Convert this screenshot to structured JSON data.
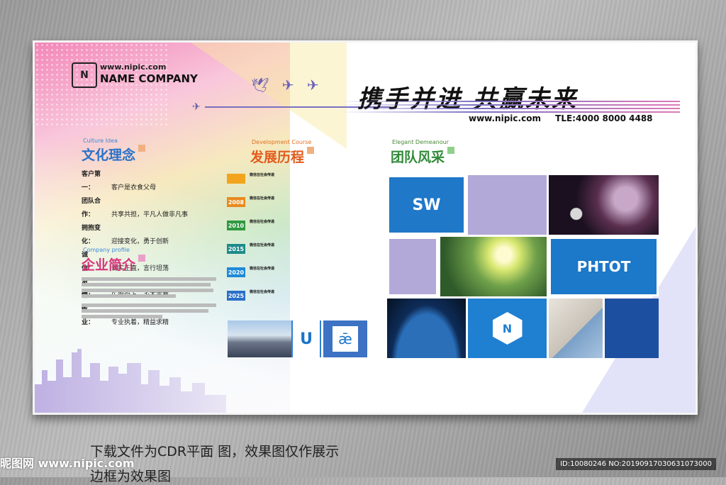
{
  "header": {
    "site_url": "www.nipic.com",
    "company": "NAME COMPANY",
    "logo_text": "N",
    "slogan": "携手并进 共赢未来",
    "contact_url": "www.nipic.com",
    "phone": "TLE:4000 8000 4488"
  },
  "culture": {
    "en": "Culture Idea",
    "title": "文化理念",
    "items": [
      {
        "k": "客户第一：",
        "v": "客户是衣食父母"
      },
      {
        "k": "团队合作：",
        "v": "共享共担，平凡人做非凡事"
      },
      {
        "k": "拥抱变化：",
        "v": "迎接变化，勇于创新"
      },
      {
        "k": "诚　　信：",
        "v": "诚实正直，言行坦荡"
      },
      {
        "k": "激　　情：",
        "v": "乐观向上，永不言弃"
      },
      {
        "k": "敬　　业：",
        "v": "专业执着，精益求精"
      }
    ]
  },
  "profile": {
    "en": "Company profile",
    "title": "企业简介"
  },
  "development": {
    "en": "Development Course",
    "title": "发展历程",
    "years": [
      {
        "year": "",
        "color": "#f2a51c"
      },
      {
        "year": "2008",
        "color": "#e88a1e"
      },
      {
        "year": "2010",
        "color": "#2f9a3f"
      },
      {
        "year": "2015",
        "color": "#1f8a8a"
      },
      {
        "year": "2020",
        "color": "#1e8ad8"
      },
      {
        "year": "2025",
        "color": "#2b6fc8"
      }
    ],
    "entry_title": "微信在社会传递",
    "u_tile": "U",
    "e_tile": "ǣ"
  },
  "team": {
    "en": "Elegant Demeanour",
    "title": "团队风采",
    "tile_sw": "SW",
    "tile_photo": "PHTOT",
    "tile_logo": "N"
  },
  "footer": {
    "caption_line1": "下载文件为CDR平面 图，效果图仅作展示",
    "caption_line2": "边框为效果图",
    "watermark": "昵图网 www.nipic.com",
    "id_text": "ID:10080246 NO:20190917030631073000"
  }
}
